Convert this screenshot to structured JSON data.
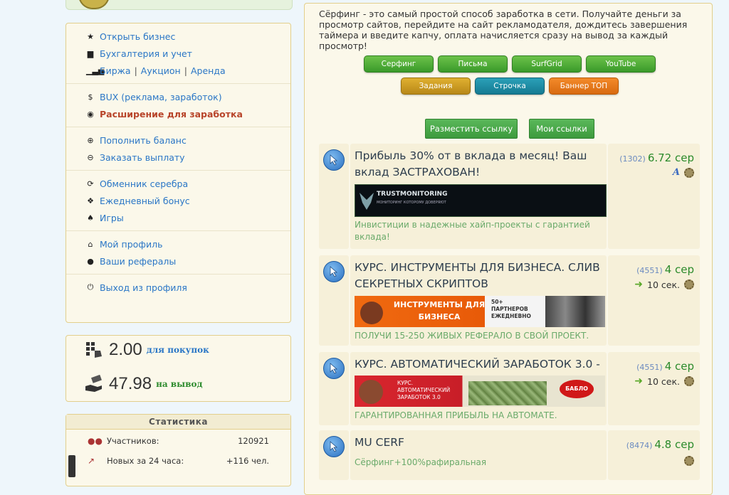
{
  "sidebar": {
    "menu_groups": [
      {
        "items": [
          {
            "icon": "star-icon",
            "label": "Открыть бизнес"
          },
          {
            "icon": "briefcase-icon",
            "label": "Бухгалтерия и учет"
          },
          {
            "icon": "bars-icon",
            "links": [
              "Биржа",
              "Аукцион",
              "Аренда"
            ]
          }
        ]
      },
      {
        "items": [
          {
            "icon": "bux-icon",
            "label": "BUX (реклама, заработок)"
          },
          {
            "icon": "extension-icon",
            "label": "Расширение для заработка",
            "accent": "#b8442a"
          }
        ]
      },
      {
        "items": [
          {
            "icon": "plus-circle-icon",
            "label": "Пополнить баланс"
          },
          {
            "icon": "minus-circle-icon",
            "label": "Заказать выплату"
          }
        ]
      },
      {
        "items": [
          {
            "icon": "refresh-icon",
            "label": "Обменник серебра"
          },
          {
            "icon": "gift-icon",
            "label": "Ежедневный бонус"
          },
          {
            "icon": "spade-icon",
            "label": "Игры"
          }
        ]
      },
      {
        "items": [
          {
            "icon": "home-icon",
            "label": "Мой профиль"
          },
          {
            "icon": "user-icon",
            "label": "Ваши рефералы"
          }
        ]
      },
      {
        "items": [
          {
            "icon": "power-icon",
            "label": "Выход из профиля"
          }
        ]
      }
    ],
    "balance": {
      "purchase": {
        "amount": "2.00",
        "label": "для покупок"
      },
      "withdraw": {
        "amount": "47.98",
        "label": "на вывод"
      }
    },
    "stats": {
      "title": "Статистика",
      "rows": [
        {
          "icon": "people-icon",
          "label": "Участников:",
          "value": "120921"
        },
        {
          "icon": "trend-icon",
          "label": "Новых за 24 часа:",
          "value": "+116 чел."
        }
      ]
    }
  },
  "main": {
    "intro": "Сёрфинг - это самый простой способ заработка в сети. Получайте деньги за просмотр сайтов, перейдите на сайт рекламодателя, дождитесь завершения таймера и введите капчу, оплата начисляется сразу на вывод за каждый просмотр!",
    "tabs_row1": [
      "Серфинг",
      "Письма",
      "SurfGrid",
      "YouTube"
    ],
    "tabs_row2": [
      "Задания",
      "Строчка",
      "Баннер ТОП"
    ],
    "actions": [
      "Разместить ссылку",
      "Мои ссылки"
    ],
    "ads": [
      {
        "title": "Прибыль 30% от в вклада в месяц! Ваш вклад ЗАСТРАХОВАН!",
        "banner": "TRUSTMONITORING",
        "banner_sub": "МОНИТОРИНГ КОТОРОМУ ДОВЕРЯЮТ",
        "desc": "Инвистиции в надежные хайп-проекты с гарантией вклада!",
        "views": "(1302)",
        "price": "6.72 сер",
        "meta": "A"
      },
      {
        "title": "КУРС. ИНСТРУМЕНТЫ ДЛЯ БИЗНЕСА. СЛИВ СЕКРЕТНЫХ СКРИПТОВ",
        "banner": "ИНСТРУМЕНТЫ ДЛЯ БИЗНЕСА",
        "banner_sub": "50+ ПАРТНЕРОВ ЕЖЕДНЕВНО",
        "desc": "ПОЛУЧИ 15-250 ЖИВЫХ РЕФЕРАЛО В СВОЙ ПРОЕКТ.",
        "views": "(4551)",
        "price": "4 сер",
        "meta": "10 сек."
      },
      {
        "title": "КУРС. АВТОМАТИЧЕСКИЙ ЗАРАБОТОК 3.0 -",
        "banner": "КУРС. АВТОМАТИЧЕСКИЙ ЗАРАБОТОК 3.0",
        "banner_sub": "БАБЛО",
        "desc": "ГАРАНТИРОВАННАЯ ПРИБЫЛЬ НА АВТОМАТЕ.",
        "views": "(4551)",
        "price": "4 сер",
        "meta": "10 сек."
      },
      {
        "title": "MU CERF",
        "desc": "Сёрфинг+100%рафиральная",
        "views": "(8474)",
        "price": "4.8 сер"
      }
    ]
  }
}
